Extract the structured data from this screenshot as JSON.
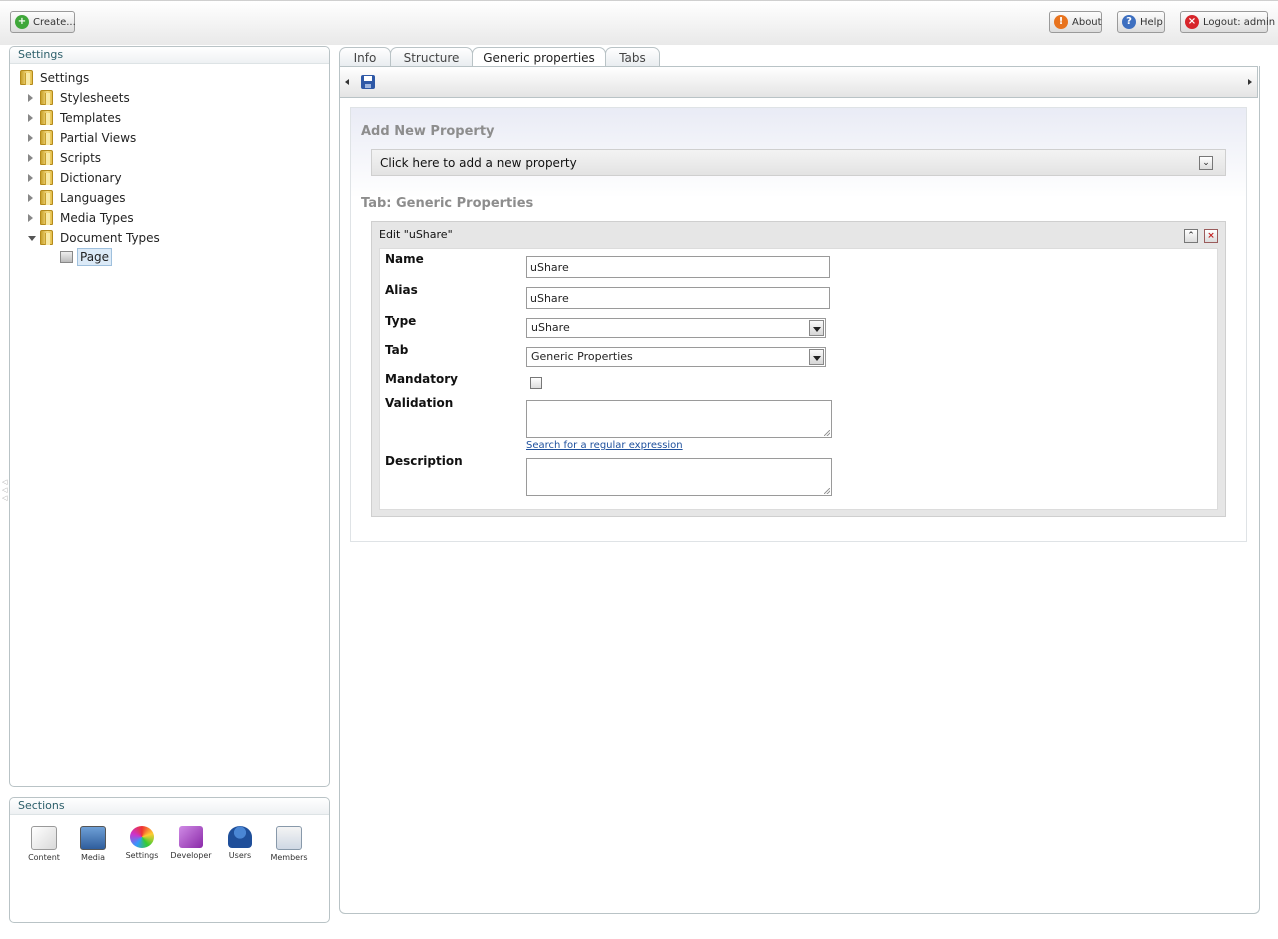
{
  "topbar": {
    "create_label": "Create...",
    "about_label": "About",
    "help_label": "Help",
    "logout_label": "Logout: admin"
  },
  "tree": {
    "title": "Settings",
    "root": "Settings",
    "items": [
      {
        "label": "Stylesheets"
      },
      {
        "label": "Templates"
      },
      {
        "label": "Partial Views"
      },
      {
        "label": "Scripts"
      },
      {
        "label": "Dictionary"
      },
      {
        "label": "Languages"
      },
      {
        "label": "Media Types"
      },
      {
        "label": "Document Types"
      }
    ],
    "child": "Page"
  },
  "sections": {
    "title": "Sections",
    "items": [
      {
        "label": "Content"
      },
      {
        "label": "Media"
      },
      {
        "label": "Settings"
      },
      {
        "label": "Developer"
      },
      {
        "label": "Users"
      },
      {
        "label": "Members"
      }
    ]
  },
  "tabs": [
    {
      "label": "Info"
    },
    {
      "label": "Structure"
    },
    {
      "label": "Generic properties"
    },
    {
      "label": "Tabs"
    }
  ],
  "content": {
    "add_heading": "Add New Property",
    "add_bar": "Click here to add a new property",
    "tab_heading": "Tab: Generic Properties",
    "edit_title": "Edit \"uShare\"",
    "fields": {
      "name_label": "Name",
      "name_value": "uShare",
      "alias_label": "Alias",
      "alias_value": "uShare",
      "type_label": "Type",
      "type_value": "uShare",
      "tab_label": "Tab",
      "tab_value": "Generic Properties",
      "mandatory_label": "Mandatory",
      "validation_label": "Validation",
      "regex_link": "Search for a regular expression",
      "description_label": "Description"
    }
  },
  "colors": {
    "accent": "#2c5f6a",
    "panel_border": "#b9c3c6",
    "heading_grey": "#8d8d8d"
  }
}
